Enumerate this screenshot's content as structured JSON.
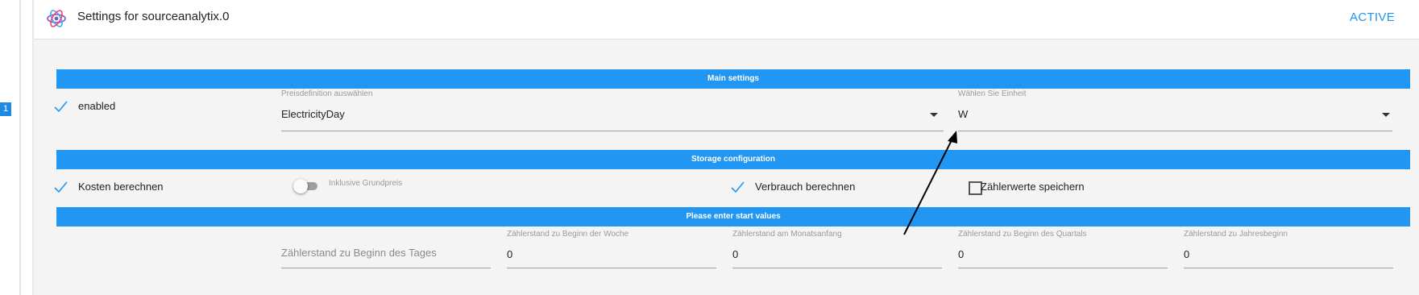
{
  "row": {
    "badge": "1"
  },
  "header": {
    "title": "Settings for sourceanalytix.0",
    "status": "ACTIVE"
  },
  "sections": {
    "main": "Main settings",
    "storage": "Storage configuration",
    "start": "Please enter start values"
  },
  "main": {
    "enabled_label": "enabled",
    "price_label": "Preisdefinition auswählen",
    "price_value": "ElectricityDay",
    "unit_label": "Wählen Sie Einheit",
    "unit_value": "W"
  },
  "storage": {
    "costs_label": "Kosten berechnen",
    "base_price_label": "Inklusive Grundpreis",
    "consumption_label": "Verbrauch berechnen",
    "meter_label": "Zählerwerte speichern"
  },
  "start": {
    "day_placeholder": "Zählerstand zu Beginn des Tages",
    "week_label": "Zählerstand zu Beginn der Woche",
    "week_value": "0",
    "month_label": "Zählerstand am Monatsanfang",
    "month_value": "0",
    "quarter_label": "Zählerstand zu Beginn des Quartals",
    "quarter_value": "0",
    "year_label": "Zählerstand zu Jahresbeginn",
    "year_value": "0"
  },
  "colors": {
    "accent": "#2196f3",
    "badge": "#1e88e5"
  },
  "icons": {
    "logo": "sourceanalytix-logo",
    "check": "check-icon",
    "caret": "caret-down-icon"
  }
}
